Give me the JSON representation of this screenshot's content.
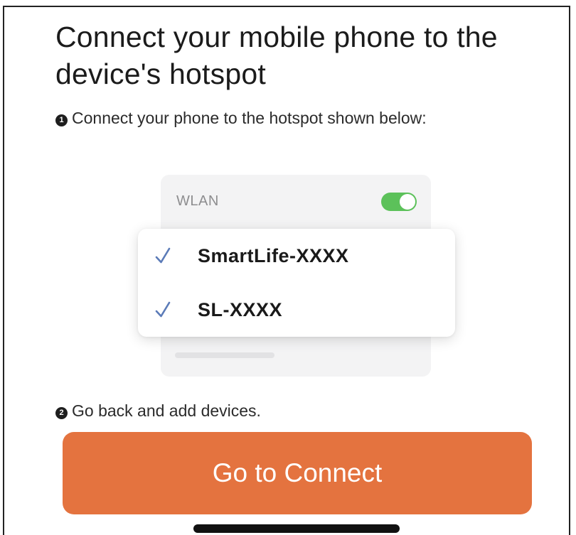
{
  "header": {
    "title": "Connect your mobile phone to the device's hotspot"
  },
  "steps": [
    {
      "number": "1",
      "text": "Connect your phone to the hotspot shown below:"
    },
    {
      "number": "2",
      "text": "Go back and add devices."
    }
  ],
  "wlan": {
    "label": "WLAN",
    "toggle_on": true,
    "toggle_color": "#5cc15a"
  },
  "networks": [
    {
      "name": "SmartLife-XXXX",
      "icon": "checkmark-icon"
    },
    {
      "name": "SL-XXXX",
      "icon": "checkmark-icon"
    }
  ],
  "actions": {
    "connect_label": "Go to Connect",
    "connect_color": "#e4733f"
  }
}
